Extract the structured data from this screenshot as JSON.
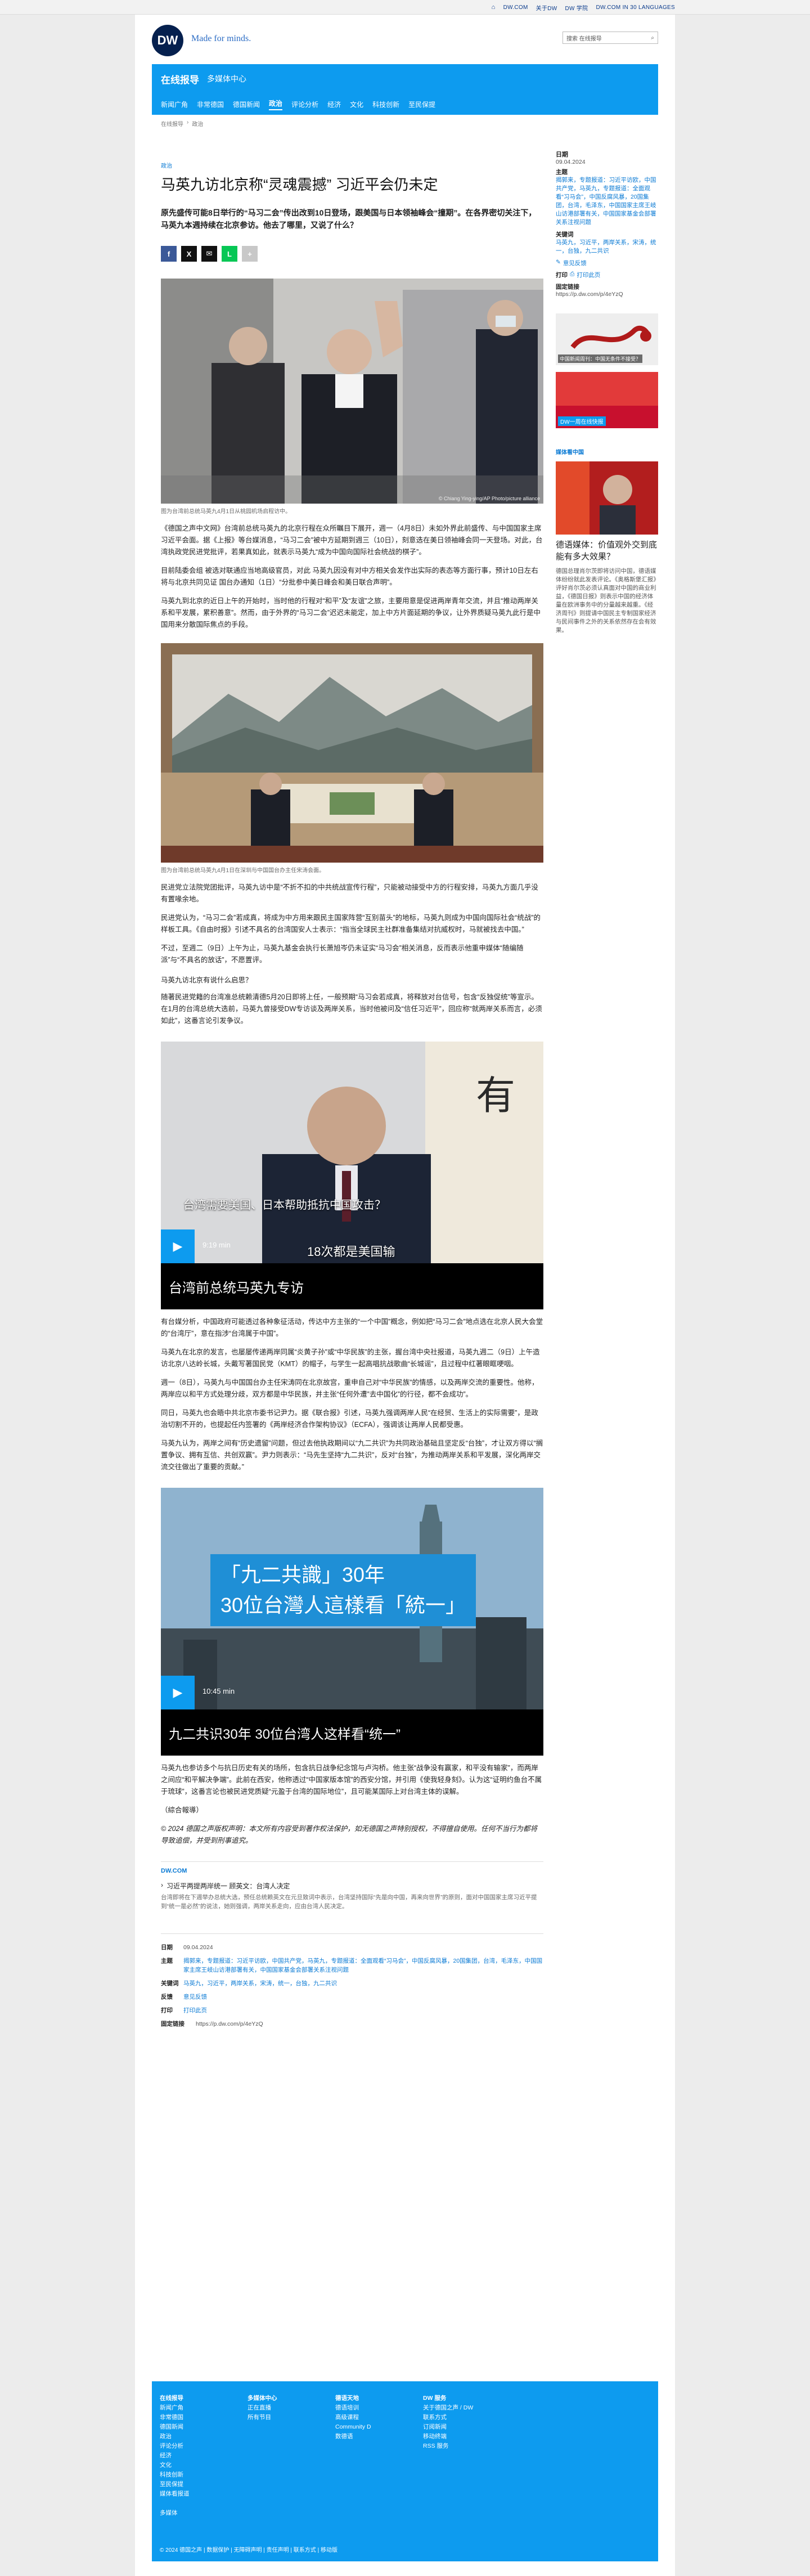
{
  "topbar": {
    "links": [
      "DW.COM",
      "关于DW",
      "DW 学院",
      "DW.COM IN 30 LANGUAGES"
    ]
  },
  "brand": {
    "logo": "DW",
    "tagline": "Made for minds.",
    "search_placeholder": "搜索 在线报导"
  },
  "nav": {
    "title": "在线报导",
    "subtitle": "多媒体中心",
    "sections": [
      "新闻广角",
      "非常德国",
      "德国新闻",
      "政治",
      "评论分析",
      "经济",
      "文化",
      "科技创新",
      "至民保提"
    ],
    "active": "政治"
  },
  "breadcrumb": [
    "在线报导",
    "政治"
  ],
  "article": {
    "kicker": "政治",
    "headline": "马英九访北京称“灵魂震撼” 习近平会仍未定",
    "lead": "原先盛传可能8日举行的“马习二会”传出改到10日登场，跟美国与日本领袖峰会“撞期”。在各界密切关注下，马英九本週持续在北京参访。他去了哪里，又说了什么？",
    "share_icons": [
      "facebook-icon",
      "x-icon",
      "mail-icon",
      "line-icon",
      "plus-icon"
    ],
    "image1_credit": "© Chiang Ying-ying/AP Photo/picture alliance",
    "image1_caption": "图为台湾前总统马英九4月1日从桃园机场启程访中。",
    "p1": "《德国之声中文网》台湾前总统马英九的北京行程在众所瞩目下展开，週一（4月8日）未如外界此前盛传、与中国国家主席习近平会面。据《上报》等台媒消息，“马习二会”被中方延期到週三（10日），刻意选在美日领袖峰会同一天登场。对此，台湾执政党民进党批评，若果真如此，就表示马英九“成为中国向国际社会统战的棋子”。",
    "p1_link": "马习二会",
    "p2": "目前陆委会组 被选对联通应当地高级官员，对此 马英九因没有对中方相关会发作出实际的表态等方面行事，预计10日左右将与北京共同见证 国台办通知（1日）“分批参中美日峰会和美日联合声明”。",
    "p3": "马英九到北京的近日上午的开始时，当时他的行程对“和平”及“友谊”之旅，主要用意是促进两岸青年交流，并且“推动两岸关系和平发展，累积善意”。然而，由于外界的“马习二会”迟迟未能定，加上中方片面延期的争议，让外界质疑马英九此行是中国用来分散国际焦点的手段。",
    "image2_caption": "图为台湾前总统马英九4月1日在深圳与中国国台办主任宋涛会面。",
    "p4": "民进党立法院党团批评，马英九访中是“不折不扣的中共统战宣传行程”，只能被动接受中方的行程安排，马英九方面几乎没有置喙余地。",
    "p5": "民进党认为，“马习二会”若成真，将成为中方用来跟民主国家阵营“互别苗头”的地标，马英九则成为中国向国际社会“统战”的样板工具。《自由时报》引述不具名的台湾国安人士表示：“指当全球民主社群准备集结对抗威权时，马就被找去中国。”",
    "p6": "不过，至週二（9日）上午为止，马英九基金会执行长萧旭岑仍未证实“马习会”相关消息，反而表示他重申媒体“随编随派”与“不具名的放话”，不愿置评。",
    "subhead1": "马英九访北京有说什么启思？",
    "p7": "随著民进党籍的台湾准总统赖清德5月20日即将上任，一般预期“马习会若成真，将释放对台信号，包含“反独促统”等宣示。在1月的台湾总统大选前，马英九曾接受DW专访谈及两岸关系，当时他被问及“信任习近平”，回应称“就两岸关系而言，必须如此”，这番言论引发争议。",
    "video1_overlay": "台湾需要美国、日本帮助抵抗中国攻击？",
    "video1_sub": "18次都是美国输",
    "video1_duration": "9:19 min",
    "video1_title": "台湾前总统马英九专访",
    "p8": "有台媒分析，中国政府可能透过各种象征活动，传达中方主张的“一个中国”概念，例如把“马习二会”地点选在北京人民大会堂的“台湾厅”，意在指涉“台湾属于中国”。",
    "p9": "马英九在北京的发言，也屡屡传递两岸同属“炎黄子孙”或“中华民族”的主张，握台湾中央社报道，马英九週二（9日）上午造访北京八达岭长城，头戴写著国民党（KMT）的帽子，与学生一起高唱抗战歌曲“长城谣”，且过程中红著眼眶哽咽。",
    "p10": "週一（8日），马英九与中国国台办主任宋涛同在北京故宫，重申自己对“中华民族”的情感，以及两岸交流的重要性。他称，两岸应以和平方式处理分歧，双方都是中华民族，并主张“任何外遭”去中国化”的行径，都不会成功”。",
    "p11": "同日，马英九也会晤中共北京市委书记尹力。据《联合报》引述，马英九强调两岸人民“在经贸、生活上的实际需要”，是政治切割不开的，也提起任内签署的《两岸经济合作架构协议》（ECFA），强调该让两岸人民都受惠。",
    "p12": "马英九认为，两岸之间有“历史遗留”问题，但过去他执政期间以“九二共识”为共同政治基础且坚定反“台独”，才让双方得以“搁置争议、拥有互信、共创双赢”。尹力则表示：“马先生坚持“九二共识”，反对“台独”，为推动两岸关系和平发展，深化两岸交流交往做出了重要的贡献。”",
    "video2_overlay_line1": "「九二共識」30年",
    "video2_overlay_line2": "30位台灣人這樣看「統一」",
    "video2_duration": "10:45 min",
    "video2_title": "九二共识30年 30位台湾人这样看“统一”",
    "p13": "马英九也参访多个与抗日历史有关的场所，包含抗日战争纪念馆与卢沟桥。他主张“战争没有赢家，和平没有输家”，而两岸之间应“和平解决争端”。此前在西安，他称透过“中国家版本馆”的西安分馆，并引用《使我轻身刻》。认为这“证明约鱼台不属于琉球”，这番言论也被民进党质疑“元盈于台湾的国际地位”，且可能某国际上对台湾主体的误解。",
    "signature": "（綜合報導）",
    "copyright": "© 2024 德国之声版权声明：本文所有内容受到著作权法保护，如无德国之声特别授权，不得擅自使用。任何不当行为都将导致追偿，并受到刑事追究。",
    "dwcom": "DW.COM",
    "related_title": "习近平两提两岸统一  顾英文：台湾人决定",
    "related_text": "台湾即将在下週举办总统大选，预任总统赖英文在元旦致词中表示，台湾坚持国际“先是向中国，再来向世界”的原则，面对中国国家主席习近平提到“统一是必然”的说法，她则强调，两岸关系走向，应由台湾人民决定。"
  },
  "meta": {
    "date_label": "日期",
    "date": "09.04.2024",
    "topics_label": "主题",
    "topics": "揭郭来，专题报道：习近平访欧，中国共产党，马英九，专题报道：全面观看“习马会”，中国反腐风暴，20国集团，台湾，毛泽东，中国国家主席王岐山访港部署有关，中国国家基金会部署关系注视问题",
    "keywords_label": "关键词",
    "keywords": "马英九，习近平，两岸关系，宋涛，统一，台独，九二共识",
    "feedback_label": "反馈",
    "feedback": "意见反馈",
    "print_label": "打印",
    "print": "打印此页",
    "permalink_label": "固定链接",
    "permalink": "https://p.dw.com/p/4eYzQ"
  },
  "sidebar": {
    "date_label": "日期",
    "date": "09.04.2024",
    "topics_label": "主题",
    "topics": "揭郭来，专题报道：习近平访欧，中国共产党，马英九，专题报道：全面观看“习马会”，中国反腐风暴，20国集团，台湾，毛泽东，中国国家主席王岐山访港部署有关，中国国家基金会部署关系注视问题",
    "keywords_label": "关键词",
    "keywords": "马英九，习近平，两岸关系，宋涛，统一，台独，九二共识",
    "feedback": "意见反馈",
    "print_label": "打印",
    "print": "打印此页",
    "permalink_label": "固定链接",
    "permalink": "https://p.dw.com/p/4eYzQ",
    "thumb1_caption": "中国新闻周刊：中国无条件不接受？",
    "thumb2_caption": "DW一周在线快报",
    "section_label": "媒体看中国",
    "article_title": "德语媒体：价值观外交到底能有多大效果？",
    "article_text": "德国总理肖尔茨即将访问中国，德语媒体纷纷就此发表评论。《奥格斯堡汇报》评好肖尔茨必须认真面对中国的商业利益，《德国日报》则表示中国的经济体量在欧洲事务中的分量越来越重。《经济周刊》则提请中国民主专制国家经济与民间事件之外的关系依然存在会有效果。"
  },
  "footer": {
    "cols": [
      {
        "title": "在线报导",
        "items": [
          "新闻广角",
          "非常德国",
          "德国新闻",
          "政治",
          "评论分析",
          "经济",
          "文化",
          "科技创新",
          "至民保提",
          "媒体看报道",
          "",
          "多媒体"
        ]
      },
      {
        "title": "多媒体中心",
        "items": [
          "正在直播",
          "所有节目"
        ]
      },
      {
        "title": "德语天地",
        "items": [
          "德语培训",
          "高级课程",
          "Community D",
          "数德语"
        ]
      },
      {
        "title": "DW 服务",
        "items": [
          "关于德国之声 / DW",
          "联系方式",
          "订阅新闻",
          "移动终端",
          "RSS 服务"
        ]
      }
    ],
    "bottom_items": [
      "© 2024 德国之声",
      "数据保护",
      "无障碍声明",
      "责任声明",
      "联系方式",
      "移动版"
    ]
  }
}
